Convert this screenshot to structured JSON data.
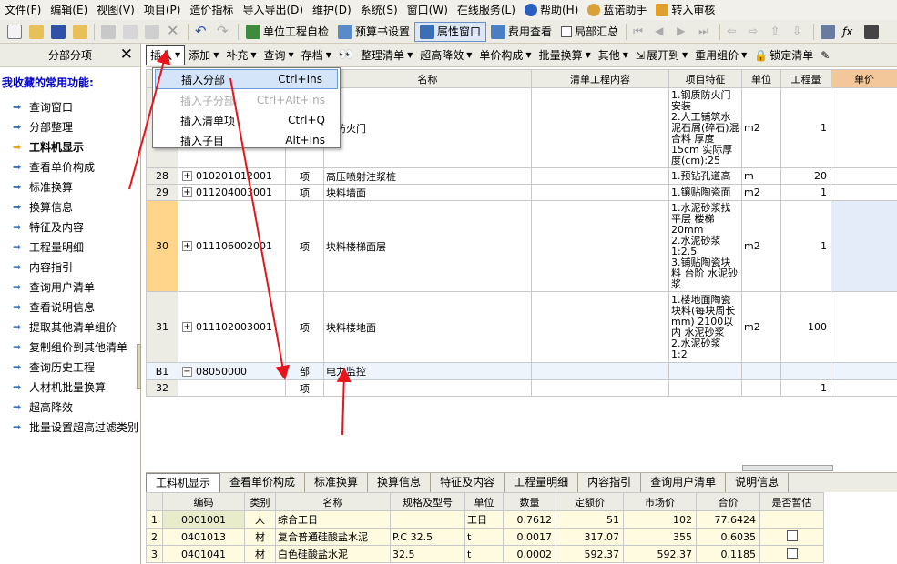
{
  "menubar": {
    "items": [
      {
        "label": "文件(F)"
      },
      {
        "label": "编辑(E)"
      },
      {
        "label": "视图(V)"
      },
      {
        "label": "项目(P)"
      },
      {
        "label": "造价指标"
      },
      {
        "label": "导入导出(D)"
      },
      {
        "label": "维护(D)"
      },
      {
        "label": "系统(S)"
      },
      {
        "label": "窗口(W)"
      },
      {
        "label": "在线服务(L)"
      },
      {
        "label": "帮助(H)",
        "icon": "help-icon"
      },
      {
        "label": "蓝诺助手",
        "icon": "assistant-icon"
      },
      {
        "label": "转入审核",
        "icon": "review-icon"
      }
    ]
  },
  "toolbar1": {
    "self_check": "单位工程自检",
    "budget_settings": "预算书设置",
    "property_window": "属性窗口",
    "fee_view": "费用查看",
    "local_summary": "局部汇总"
  },
  "left": {
    "header": "分部分项",
    "subtitle": "我收藏的常用功能:",
    "items": [
      {
        "label": "查询窗口"
      },
      {
        "label": "分部整理"
      },
      {
        "label": "工料机显示"
      },
      {
        "label": "查看单价构成"
      },
      {
        "label": "标准换算"
      },
      {
        "label": "换算信息"
      },
      {
        "label": "特征及内容"
      },
      {
        "label": "工程量明细"
      },
      {
        "label": "内容指引"
      },
      {
        "label": "查询用户清单"
      },
      {
        "label": "查看说明信息"
      },
      {
        "label": "提取其他清单组价"
      },
      {
        "label": "复制组价到其他清单"
      },
      {
        "label": "查询历史工程"
      },
      {
        "label": "人材机批量换算"
      },
      {
        "label": "超高降效"
      },
      {
        "label": "批量设置超高过滤类别"
      }
    ]
  },
  "toolbar2": {
    "items": [
      "插入",
      "添加",
      "补充",
      "查询",
      "存档",
      "整理清单",
      "超高降效",
      "单价构成",
      "批量换算",
      "其他",
      "展开到",
      "重用组价",
      "锁定清单"
    ]
  },
  "dropdown": {
    "items": [
      {
        "label": "插入分部",
        "shortcut": "Ctrl+Ins"
      },
      {
        "label": "插入子分部",
        "shortcut": "Ctrl+Alt+Ins"
      },
      {
        "label": "插入清单项",
        "shortcut": "Ctrl+Q"
      },
      {
        "label": "插入子目",
        "shortcut": "Alt+Ins"
      }
    ]
  },
  "grid": {
    "headers": {
      "name": "名称",
      "content": "清单工程内容",
      "feature": "项目特征",
      "unit": "单位",
      "qty": "工程量",
      "price": "单价"
    },
    "rows": [
      {
        "no": "",
        "code": "",
        "type": "",
        "name": "质防火门",
        "feature": "1.钢质防火门安装\n2.人工铺筑水泥石屑(碎石)混合料 厚度15cm 实际厚度(cm):25",
        "unit": "m2",
        "qty": "1"
      },
      {
        "no": "28",
        "code": "010201012001",
        "type": "项",
        "name": "高压喷射注浆桩",
        "feature": "1.预钻孔道高",
        "unit": "m",
        "qty": "20"
      },
      {
        "no": "29",
        "code": "011204003001",
        "type": "项",
        "name": "块料墙面",
        "feature": "1.镶贴陶瓷面",
        "unit": "m2",
        "qty": "1"
      },
      {
        "no": "30",
        "code": "011106002001",
        "type": "项",
        "name": "块料楼梯面层",
        "feature": "1.水泥砂浆找平层 楼梯 20mm\n2.水泥砂浆 1:2.5\n3.铺贴陶瓷块料 台阶 水泥砂浆",
        "unit": "m2",
        "qty": "1"
      },
      {
        "no": "31",
        "code": "011102003001",
        "type": "项",
        "name": "块料楼地面",
        "feature": "1.楼地面陶瓷块料(每块周长mm) 2100以内 水泥砂浆\n2.水泥砂浆 1:2",
        "unit": "m2",
        "qty": "100"
      },
      {
        "no": "B1",
        "code": "08050000",
        "type": "部",
        "name": "电力监控",
        "feature": "",
        "unit": "",
        "qty": ""
      },
      {
        "no": "32",
        "code": "",
        "type": "项",
        "name": "",
        "feature": "",
        "unit": "",
        "qty": "1"
      }
    ]
  },
  "bottom": {
    "tabs": [
      {
        "label": "工料机显示"
      },
      {
        "label": "查看单价构成"
      },
      {
        "label": "标准换算"
      },
      {
        "label": "换算信息"
      },
      {
        "label": "特征及内容"
      },
      {
        "label": "工程量明细"
      },
      {
        "label": "内容指引"
      },
      {
        "label": "查询用户清单"
      },
      {
        "label": "说明信息"
      }
    ],
    "headers": {
      "code": "编码",
      "cat": "类别",
      "name": "名称",
      "spec": "规格及型号",
      "unit": "单位",
      "qty": "数量",
      "quota": "定额价",
      "market": "市场价",
      "total": "合价",
      "temp": "是否暂估"
    },
    "rows": [
      {
        "no": "1",
        "code": "0001001",
        "cat": "人",
        "name": "综合工日",
        "spec": "",
        "unit": "工日",
        "qty": "0.7612",
        "quota": "51",
        "market": "102",
        "total": "77.6424",
        "temp": false
      },
      {
        "no": "2",
        "code": "0401013",
        "cat": "材",
        "name": "复合普通硅酸盐水泥",
        "spec": "P.C 32.5",
        "unit": "t",
        "qty": "0.0017",
        "quota": "317.07",
        "market": "355",
        "total": "0.6035",
        "temp": true
      },
      {
        "no": "3",
        "code": "0401041",
        "cat": "材",
        "name": "白色硅酸盐水泥",
        "spec": "32.5",
        "unit": "t",
        "qty": "0.0002",
        "quota": "592.37",
        "market": "592.37",
        "total": "0.1185",
        "temp": true
      }
    ]
  },
  "colors": {
    "annotation_arrow": "#e8141c",
    "selected_row": "#ffd58c",
    "accent": "#3a6fb8"
  }
}
